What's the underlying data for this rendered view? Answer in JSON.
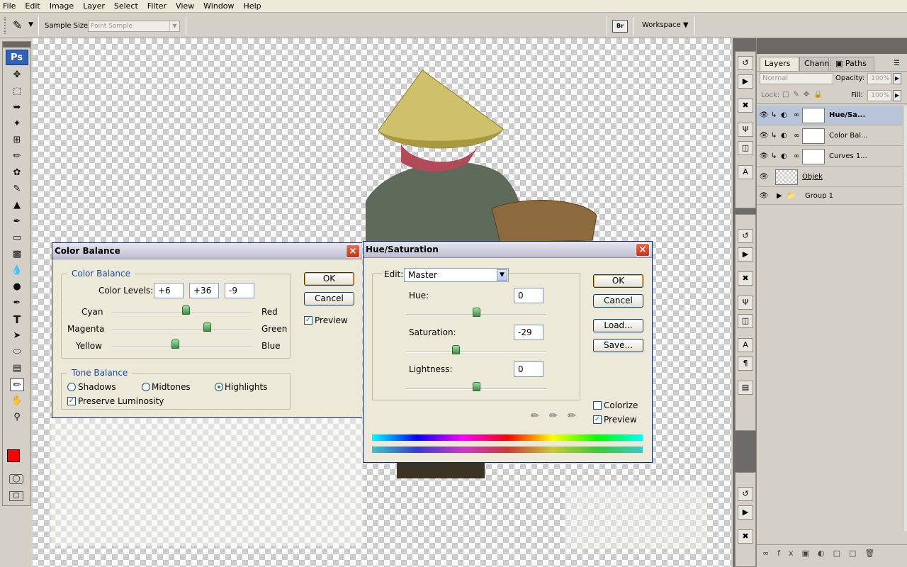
{
  "menu": [
    "File",
    "Edit",
    "Image",
    "Layer",
    "Select",
    "Filter",
    "View",
    "Window",
    "Help"
  ],
  "options_bar": {
    "sample_size_label": "Sample Size:",
    "sample_size_value": "Point Sample",
    "workspace_label": "Workspace",
    "bridge_icon": "Br"
  },
  "toolbox": {
    "logo": "Ps",
    "tools": [
      "move-tool",
      "marquee-tool",
      "lasso-tool",
      "magic-wand-tool",
      "crop-tool",
      "eyedropper-tool",
      "healing-brush-tool",
      "brush-tool",
      "clone-stamp-tool",
      "history-brush-tool",
      "eraser-tool",
      "gradient-tool",
      "blur-tool",
      "dodge-tool",
      "pen-tool",
      "type-tool",
      "path-selection-tool",
      "shape-tool",
      "notes-tool",
      "eyedropper-tool-2",
      "hand-tool",
      "zoom-tool"
    ],
    "foreground_color": "#ff0000",
    "background_color": "#ffffff"
  },
  "layers_panel": {
    "tabs": [
      "Layers",
      "Chann",
      "Paths"
    ],
    "blend_mode": "Normal",
    "opacity_label": "Opacity:",
    "opacity_value": "100%",
    "lock_label": "Lock:",
    "fill_label": "Fill:",
    "fill_value": "100%",
    "layers": [
      {
        "name": "Hue/Sa...",
        "selected": true
      },
      {
        "name": "Color Bal...",
        "selected": false
      },
      {
        "name": "Curves 1...",
        "selected": false
      },
      {
        "name": "Objek",
        "selected": false
      },
      {
        "name": "Group 1",
        "selected": false
      }
    ]
  },
  "color_balance": {
    "title": "Color Balance",
    "group_label": "Color Balance",
    "levels_label": "Color Levels:",
    "levels": [
      "+6",
      "+36",
      "-9"
    ],
    "sliders": [
      {
        "left": "Cyan",
        "right": "Red",
        "value": 6
      },
      {
        "left": "Magenta",
        "right": "Green",
        "value": 36
      },
      {
        "left": "Yellow",
        "right": "Blue",
        "value": -9
      }
    ],
    "tone_label": "Tone Balance",
    "tones": [
      "Shadows",
      "Midtones",
      "Highlights"
    ],
    "selected_tone": "Highlights",
    "preserve_label": "Preserve Luminosity",
    "ok": "OK",
    "cancel": "Cancel",
    "preview": "Preview"
  },
  "hue_saturation": {
    "title": "Hue/Saturation",
    "edit_label": "Edit:",
    "edit_value": "Master",
    "hue_label": "Hue:",
    "hue_value": "0",
    "sat_label": "Saturation:",
    "sat_value": "-29",
    "light_label": "Lightness:",
    "light_value": "0",
    "ok": "OK",
    "cancel": "Cancel",
    "load": "Load...",
    "save": "Save...",
    "colorize": "Colorize",
    "preview": "Preview"
  }
}
